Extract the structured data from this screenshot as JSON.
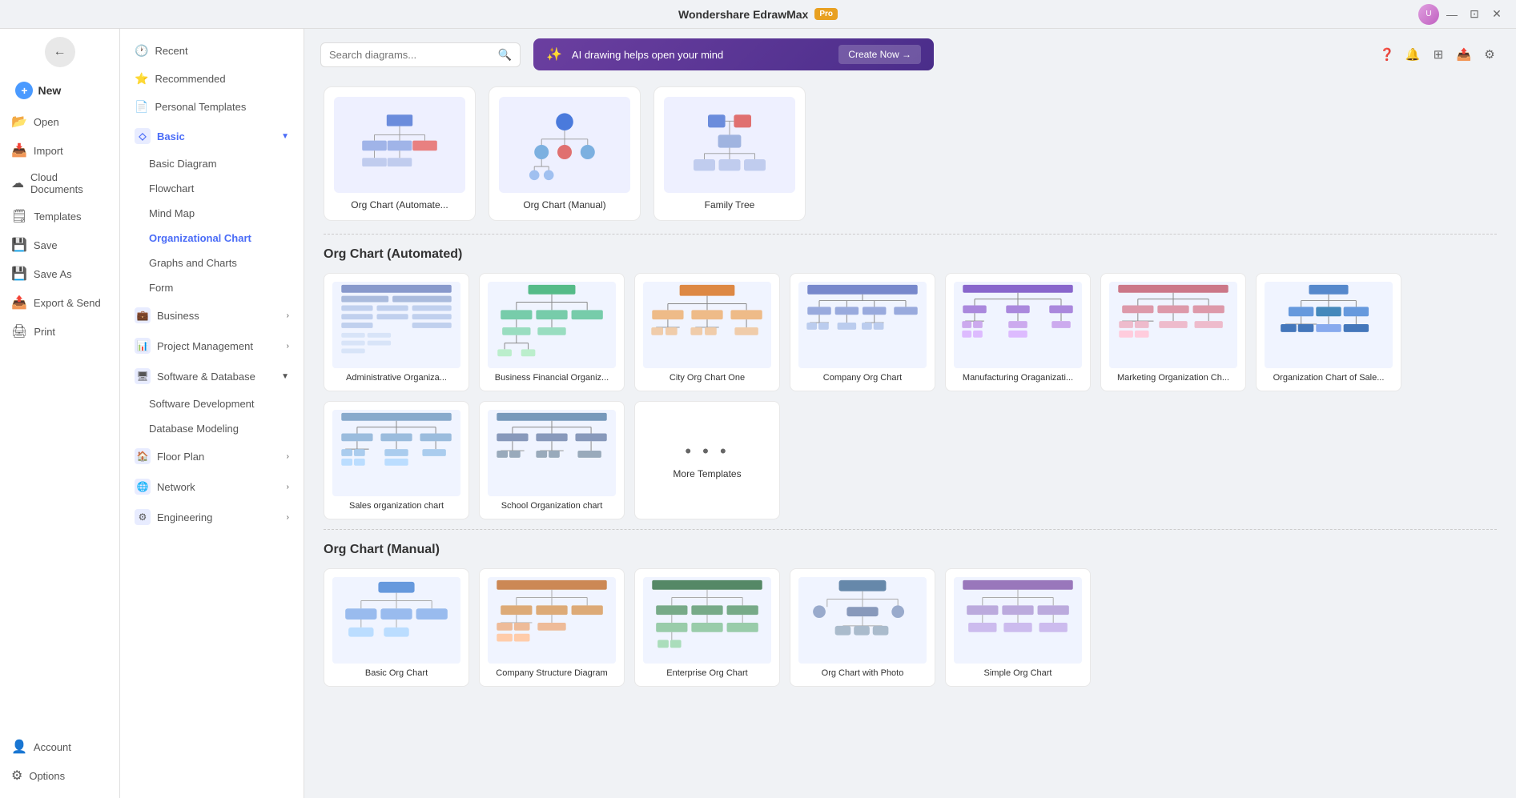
{
  "app": {
    "title": "Wondershare EdrawMax",
    "pro_badge": "Pro"
  },
  "topbar": {
    "search_placeholder": "Search diagrams...",
    "ai_banner_text": "AI drawing helps open your mind",
    "ai_banner_cta": "Create Now →"
  },
  "sidebar": {
    "back_label": "←",
    "new_label": "New",
    "items": [
      {
        "id": "open",
        "icon": "📂",
        "label": "Open"
      },
      {
        "id": "import",
        "icon": "📥",
        "label": "Import"
      },
      {
        "id": "cloud",
        "icon": "☁",
        "label": "Cloud Documents"
      },
      {
        "id": "templates",
        "icon": "🗒",
        "label": "Templates"
      },
      {
        "id": "save",
        "icon": "💾",
        "label": "Save"
      },
      {
        "id": "saveas",
        "icon": "💾",
        "label": "Save As"
      },
      {
        "id": "export",
        "icon": "📤",
        "label": "Export & Send"
      },
      {
        "id": "print",
        "icon": "🖨",
        "label": "Print"
      }
    ],
    "bottom": [
      {
        "id": "account",
        "icon": "👤",
        "label": "Account"
      },
      {
        "id": "options",
        "icon": "⚙",
        "label": "Options"
      }
    ]
  },
  "categories": {
    "top": [
      {
        "id": "recent",
        "icon": "🕐",
        "label": "Recent"
      },
      {
        "id": "recommended",
        "icon": "⭐",
        "label": "Recommended"
      },
      {
        "id": "personal",
        "icon": "📄",
        "label": "Personal Templates"
      }
    ],
    "sections": [
      {
        "id": "basic",
        "icon": "◇",
        "label": "Basic",
        "expanded": true,
        "children": [
          {
            "id": "basic-diagram",
            "label": "Basic Diagram"
          },
          {
            "id": "flowchart",
            "label": "Flowchart"
          },
          {
            "id": "mind-map",
            "label": "Mind Map"
          },
          {
            "id": "org-chart",
            "label": "Organizational Chart",
            "active": true
          },
          {
            "id": "graphs",
            "label": "Graphs and Charts"
          },
          {
            "id": "form",
            "label": "Form"
          }
        ]
      },
      {
        "id": "business",
        "icon": "💼",
        "label": "Business",
        "expanded": false
      },
      {
        "id": "project",
        "icon": "📊",
        "label": "Project Management",
        "expanded": false
      },
      {
        "id": "software",
        "icon": "🖥",
        "label": "Software & Database",
        "expanded": true,
        "children": [
          {
            "id": "software-dev",
            "label": "Software Development"
          },
          {
            "id": "database",
            "label": "Database Modeling"
          }
        ]
      },
      {
        "id": "floor",
        "icon": "🏠",
        "label": "Floor Plan",
        "expanded": false
      },
      {
        "id": "network",
        "icon": "🌐",
        "label": "Network",
        "expanded": false
      },
      {
        "id": "engineering",
        "icon": "⚙",
        "label": "Engineering",
        "expanded": false
      }
    ]
  },
  "top_cards": [
    {
      "id": "org-auto",
      "label": "Org Chart (Automate..."
    },
    {
      "id": "org-manual",
      "label": "Org Chart (Manual)"
    },
    {
      "id": "family-tree",
      "label": "Family Tree"
    }
  ],
  "sections": [
    {
      "id": "org-automated",
      "title": "Org Chart (Automated)",
      "templates": [
        {
          "id": "admin-org",
          "label": "Administrative Organiza..."
        },
        {
          "id": "biz-financial",
          "label": "Business Financial Organiz..."
        },
        {
          "id": "city-org",
          "label": "City Org Chart One"
        },
        {
          "id": "company-org",
          "label": "Company Org Chart"
        },
        {
          "id": "manufacturing",
          "label": "Manufacturing Oraganizati..."
        },
        {
          "id": "marketing-org",
          "label": "Marketing Organization Ch..."
        },
        {
          "id": "org-sales",
          "label": "Organization Chart of Sale..."
        },
        {
          "id": "sales-org",
          "label": "Sales organization chart"
        },
        {
          "id": "school-org",
          "label": "School Organization chart"
        },
        {
          "id": "more-templates",
          "label": "More Templates",
          "is_more": true
        }
      ]
    },
    {
      "id": "org-manual",
      "title": "Org Chart (Manual)",
      "templates": []
    }
  ],
  "window": {
    "minimize": "—",
    "restore": "⊡",
    "close": "✕"
  }
}
